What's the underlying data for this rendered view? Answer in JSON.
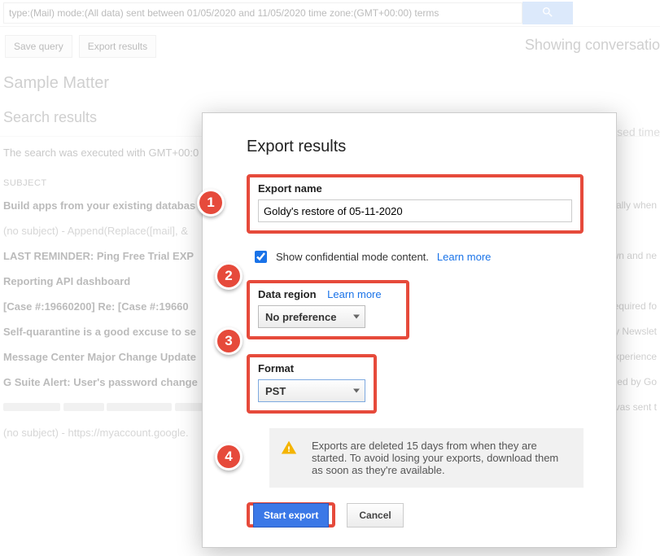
{
  "search": {
    "query": "type:(Mail) mode:(All data) sent between 01/05/2020 and 11/05/2020 time zone:(GMT+00:00) terms"
  },
  "toolbar": {
    "save_query": "Save query",
    "export_results": "Export results",
    "showing": "Showing conversatio"
  },
  "page": {
    "matter_title": "Sample Matter",
    "results_title": "Search results",
    "gmt_note": "The search was executed with GMT+00:0",
    "elapsed": "sed time",
    "subject_hdr": "SUBJECT"
  },
  "messages": [
    {
      "subject": "Build apps from your existing databas",
      "snippet": "",
      "right": "ally when"
    },
    {
      "subject": "(no subject)",
      "snippet": " - Append(Replace([mail], &",
      "right": "",
      "soft": true
    },
    {
      "subject": "LAST REMINDER: Ping Free Trial EXP",
      "snippet": "",
      "right": "wn and ne"
    },
    {
      "subject": "Reporting API dashboard",
      "snippet": "",
      "right": ""
    },
    {
      "subject": "[Case #:19660200] Re: [Case #:19660",
      "snippet": "",
      "right": "equired fo"
    },
    {
      "subject": "Self-quarantine is a good excuse to se",
      "snippet": "",
      "right": "y Newslet"
    },
    {
      "subject": "Message Center Major Change Update",
      "snippet": "",
      "right": "xperience"
    },
    {
      "subject": "G Suite Alert: User's password change",
      "snippet": "",
      "right": "ed by Go"
    },
    {
      "subject": "",
      "snippet": "",
      "right": "vas sent t",
      "redact": true
    },
    {
      "subject": "(no subject)",
      "snippet": " - https://myaccount.google.",
      "right": "",
      "soft": true
    }
  ],
  "modal": {
    "title": "Export results",
    "export_name_label": "Export name",
    "export_name_value": "Goldy's restore of 05-11-2020",
    "confidential_label": "Show confidential mode content.",
    "learn_more": "Learn more",
    "data_region_label": "Data region",
    "data_region_value": "No preference",
    "format_label": "Format",
    "format_value": "PST",
    "info": "Exports are deleted 15 days from when they are started. To avoid losing your exports, download them as soon as they're available.",
    "start": "Start export",
    "cancel": "Cancel"
  },
  "badges": {
    "1": "1",
    "2": "2",
    "3": "3",
    "4": "4"
  }
}
